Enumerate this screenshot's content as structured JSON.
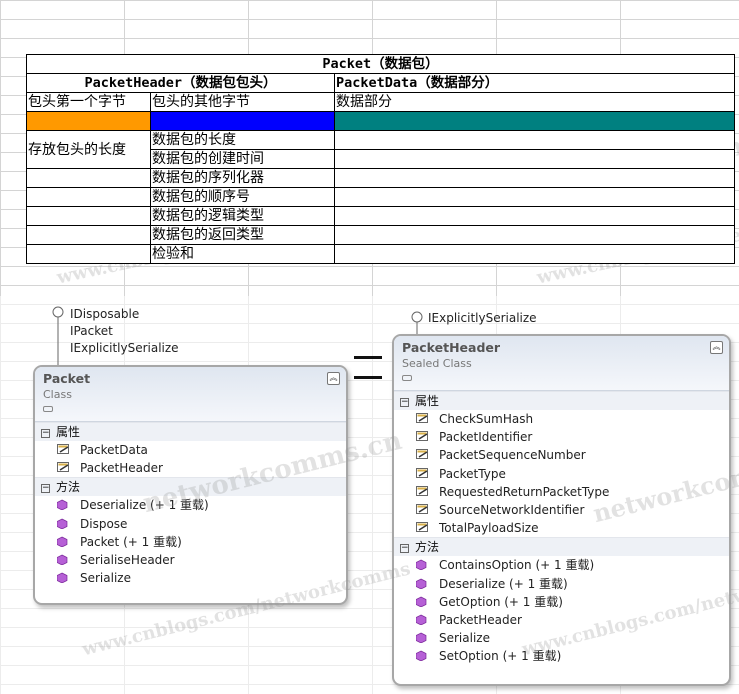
{
  "table": {
    "title": "Packet（数据包）",
    "header_col": "PacketHeader（数据包包头）",
    "data_col": "PacketData（数据部分）",
    "sub1": "包头第一个字节",
    "sub2": "包头的其他字节",
    "sub3": "数据部分",
    "colors": {
      "first_byte": "#ff9900",
      "other_bytes": "#0000ff",
      "data": "#008080"
    },
    "first_byte_desc": "存放包头的长度",
    "header_items": [
      "数据包的长度",
      "数据包的创建时间",
      "数据包的序列化器",
      "数据包的顺序号",
      "数据包的逻辑类型",
      "数据包的返回类型",
      "检验和"
    ]
  },
  "packet_class": {
    "interfaces": [
      "IDisposable",
      "IPacket",
      "IExplicitlySerialize"
    ],
    "name": "Packet",
    "kind": "Class",
    "props_title": "属性",
    "props": [
      "PacketData",
      "PacketHeader"
    ],
    "methods_title": "方法",
    "methods": [
      "Deserialize (+ 1 重载)",
      "Dispose",
      "Packet (+ 1 重载)",
      "SerialiseHeader",
      "Serialize"
    ]
  },
  "header_class": {
    "interfaces": [
      "IExplicitlySerialize"
    ],
    "name": "PacketHeader",
    "kind": "Sealed Class",
    "props_title": "属性",
    "props": [
      "CheckSumHash",
      "PacketIdentifier",
      "PacketSequenceNumber",
      "PacketType",
      "RequestedReturnPacketType",
      "SourceNetworkIdentifier",
      "TotalPayloadSize"
    ],
    "methods_title": "方法",
    "methods": [
      "ContainsOption (+ 1 重载)",
      "Deserialize (+ 1 重载)",
      "GetOption (+ 1 重载)",
      "PacketHeader",
      "Serialize",
      "SetOption (+ 1 重载)"
    ]
  },
  "watermarks": [
    "networkcomms.cn",
    "www.cnblogs.com/networkcomms"
  ]
}
